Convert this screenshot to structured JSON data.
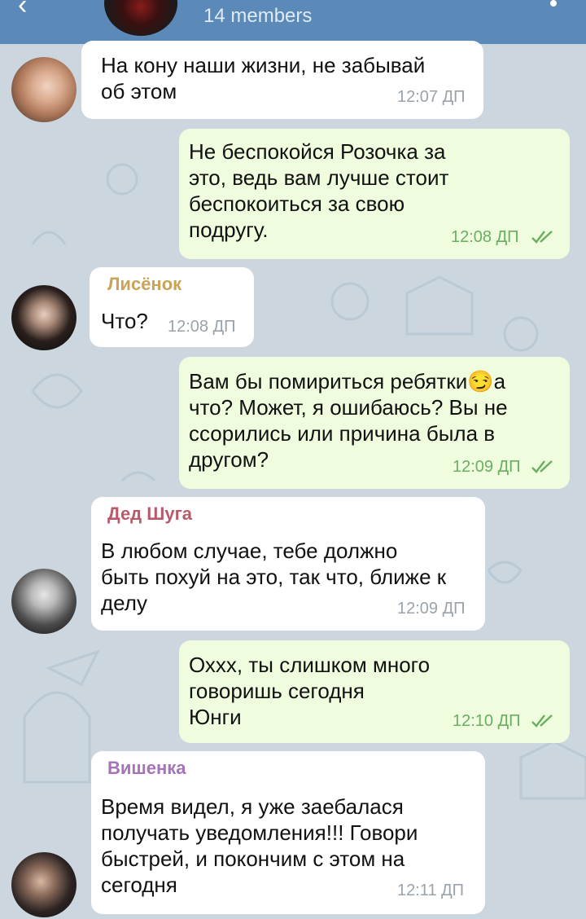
{
  "header": {
    "members": "14 members",
    "back_glyph": "‹"
  },
  "messages": [
    {
      "sender": "",
      "text": "На кону наши жизни, не забывай\nоб этом",
      "time": "12:07 ДП"
    },
    {
      "sender": "",
      "text": "Не беспокойся Розочка за\nэто, ведь вам лучше стоит\nбеспокоиться за свою\nподругу.",
      "time": "12:08 ДП"
    },
    {
      "sender": "Лисёнок",
      "text": "Что?",
      "time": "12:08 ДП"
    },
    {
      "sender": "",
      "text": "Вам бы помириться ребятки😏а\nчто? Может, я ошибаюсь? Вы не\nссорились или причина была в\nдругом?",
      "time": "12:09 ДП"
    },
    {
      "sender": "Дед Шуга",
      "text": "В любом случае, тебе должно\nбыть похуй на это, так что, ближе к\nделу",
      "time": "12:09 ДП"
    },
    {
      "sender": "",
      "text": "Оххх, ты слишком много\nговоришь сегодня\nЮнги",
      "time": "12:10 ДП"
    },
    {
      "sender": "Вишенка",
      "text": "Время видел, я уже заебалася\nполучать уведомления!!! Говори\nбыстрей, и покончим с этом на\nсегодня",
      "time": "12:11 ДП"
    }
  ],
  "colors": {
    "header": "#5b8ab8",
    "incoming_bubble": "#ffffff",
    "outgoing_bubble": "#effdde",
    "sender_lisenok": "#c8a35a",
    "sender_suga": "#b85a6a",
    "sender_vishenka": "#a673b8",
    "read_checks": "#6aae62"
  }
}
